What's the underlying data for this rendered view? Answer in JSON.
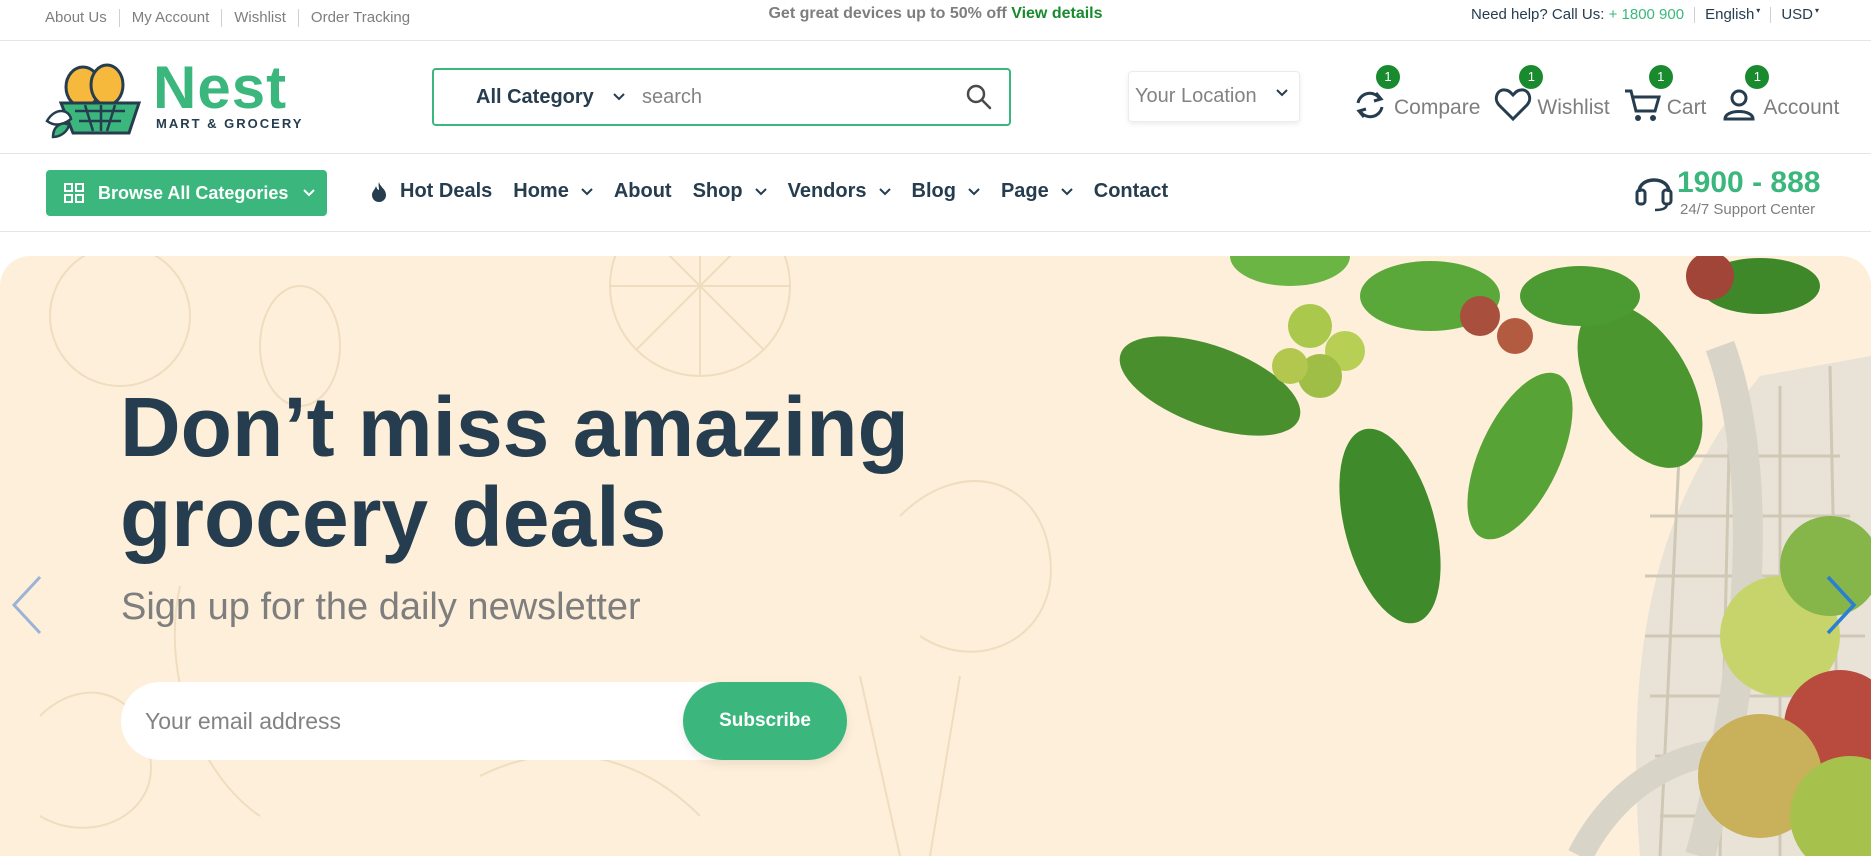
{
  "topbar": {
    "links": [
      "About Us",
      "My Account",
      "Wishlist",
      "Order Tracking"
    ],
    "promo_text": "Get great devices up to 50% off",
    "promo_link": "View details",
    "help_text": "Need help? Call Us:",
    "help_phone": "+ 1800 900",
    "language": "English",
    "currency": "USD"
  },
  "header": {
    "logo_name": "Nest",
    "logo_sub": "MART & GROCERY",
    "search": {
      "category": "All Category",
      "placeholder": "search"
    },
    "location_placeholder": "Your Location",
    "actions": [
      {
        "label": "Compare",
        "count": "1",
        "icon": "compare-icon"
      },
      {
        "label": "Wishlist",
        "count": "1",
        "icon": "heart-icon"
      },
      {
        "label": "Cart",
        "count": "1",
        "icon": "cart-icon"
      },
      {
        "label": "Account",
        "count": "1",
        "icon": "user-icon"
      }
    ]
  },
  "nav": {
    "browse_label": "Browse All Categories",
    "items": [
      "Hot Deals",
      "Home",
      "About",
      "Shop",
      "Vendors",
      "Blog",
      "Page",
      "Contact"
    ],
    "support_number": "1900 - 888",
    "support_label": "24/7 Support Center"
  },
  "hero": {
    "title_line1": "Don’t miss amazing",
    "title_line2": "grocery deals",
    "subtitle": "Sign up for the daily newsletter",
    "email_placeholder": "Your email address",
    "subscribe_label": "Subscribe"
  },
  "colors": {
    "brand_green": "#3bb77e",
    "badge_green": "#1a8a2e",
    "heading": "#253d4e",
    "muted": "#7e7e7e",
    "hero_bg": "#fdefd9"
  }
}
